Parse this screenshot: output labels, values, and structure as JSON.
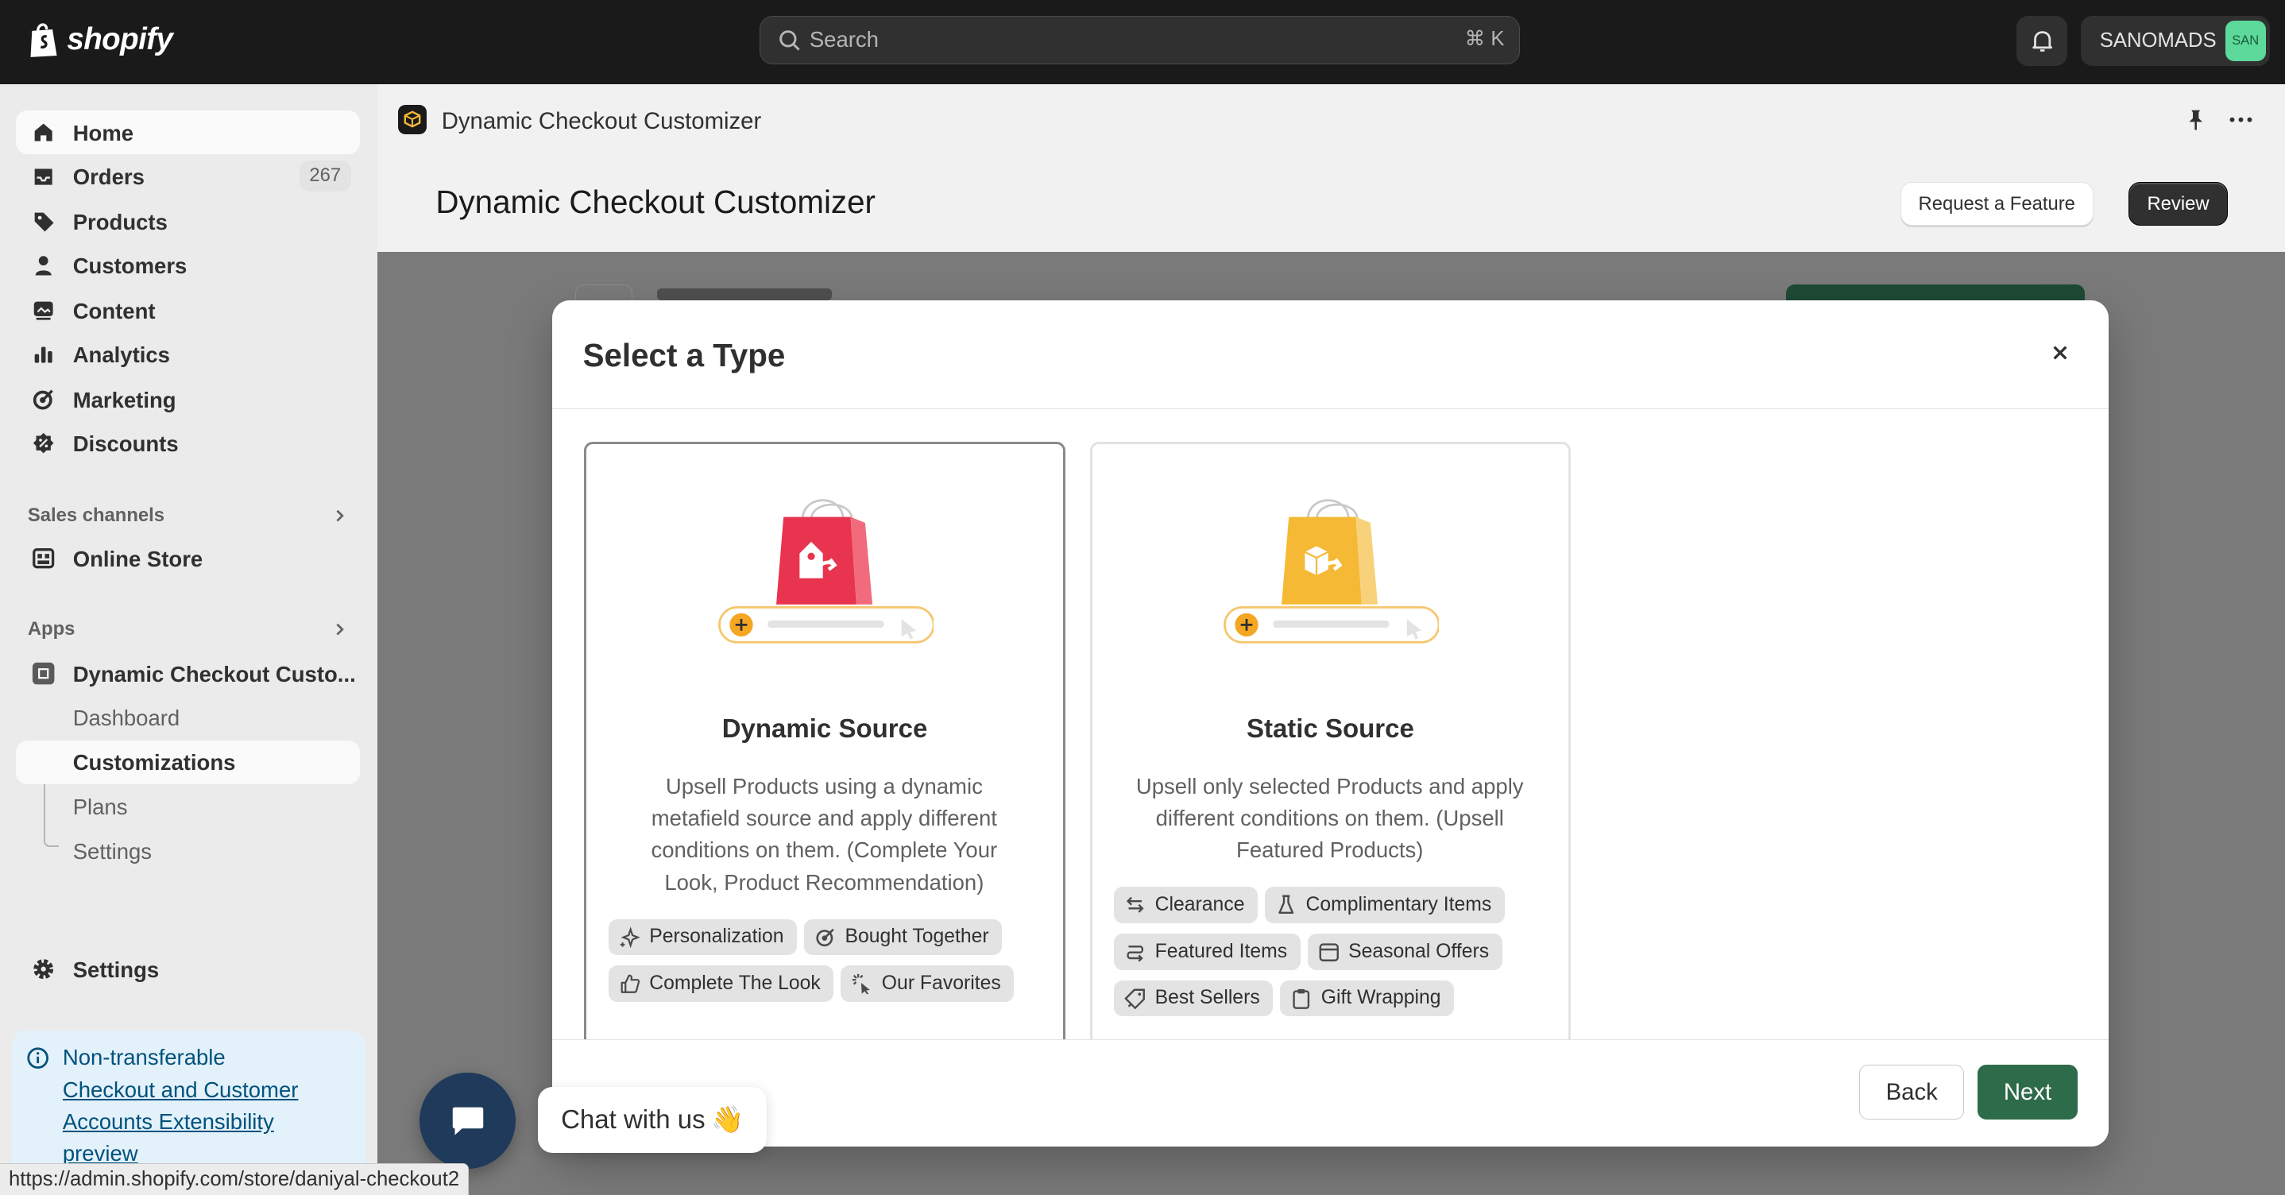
{
  "topbar": {
    "brand": "shopify",
    "search_placeholder": "Search",
    "search_shortcut": "⌘ K",
    "store_name": "SANOMADS",
    "store_initials": "SAN"
  },
  "sidebar": {
    "items": [
      {
        "label": "Home"
      },
      {
        "label": "Orders",
        "count": "267"
      },
      {
        "label": "Products"
      },
      {
        "label": "Customers"
      },
      {
        "label": "Content"
      },
      {
        "label": "Analytics"
      },
      {
        "label": "Marketing"
      },
      {
        "label": "Discounts"
      }
    ],
    "sales_channels_title": "Sales channels",
    "online_store": "Online Store",
    "apps_title": "Apps",
    "app_name": "Dynamic Checkout Custo...",
    "app_sub": [
      "Dashboard",
      "Customizations",
      "Plans",
      "Settings"
    ],
    "settings": "Settings",
    "notice": {
      "title": "Non-transferable",
      "link": "Checkout and Customer Accounts Extensibility preview"
    }
  },
  "main": {
    "app_name": "Dynamic Checkout Customizer",
    "page_title": "Dynamic Checkout Customizer",
    "request_feature": "Request a Feature",
    "review": "Review"
  },
  "modal": {
    "title": "Select a Type",
    "cards": [
      {
        "title": "Dynamic Source",
        "description": "Upsell Products using a dynamic metafield source and apply different conditions on them. (Complete Your Look, Product Recommendation)",
        "tags": [
          "Personalization",
          "Bought Together",
          "Complete The Look",
          "Our Favorites"
        ],
        "bag_color": "#e8344e"
      },
      {
        "title": "Static Source",
        "description": "Upsell only selected Products and apply different conditions on them. (Upsell Featured Products)",
        "tags": [
          "Clearance",
          "Complimentary Items",
          "Featured Items",
          "Seasonal Offers",
          "Best Sellers",
          "Gift Wrapping"
        ],
        "bag_color": "#f5b935"
      }
    ],
    "back": "Back",
    "next": "Next"
  },
  "chat": {
    "label": "Chat with us",
    "emoji": "👋"
  },
  "status_url": "https://admin.shopify.com/store/daniyal-checkout2",
  "colors": {
    "topbar": "#1a1a1a",
    "primary_button": "#2e6b4a",
    "accent_green": "#5cd99b",
    "notice_bg": "#e3f1fa"
  }
}
